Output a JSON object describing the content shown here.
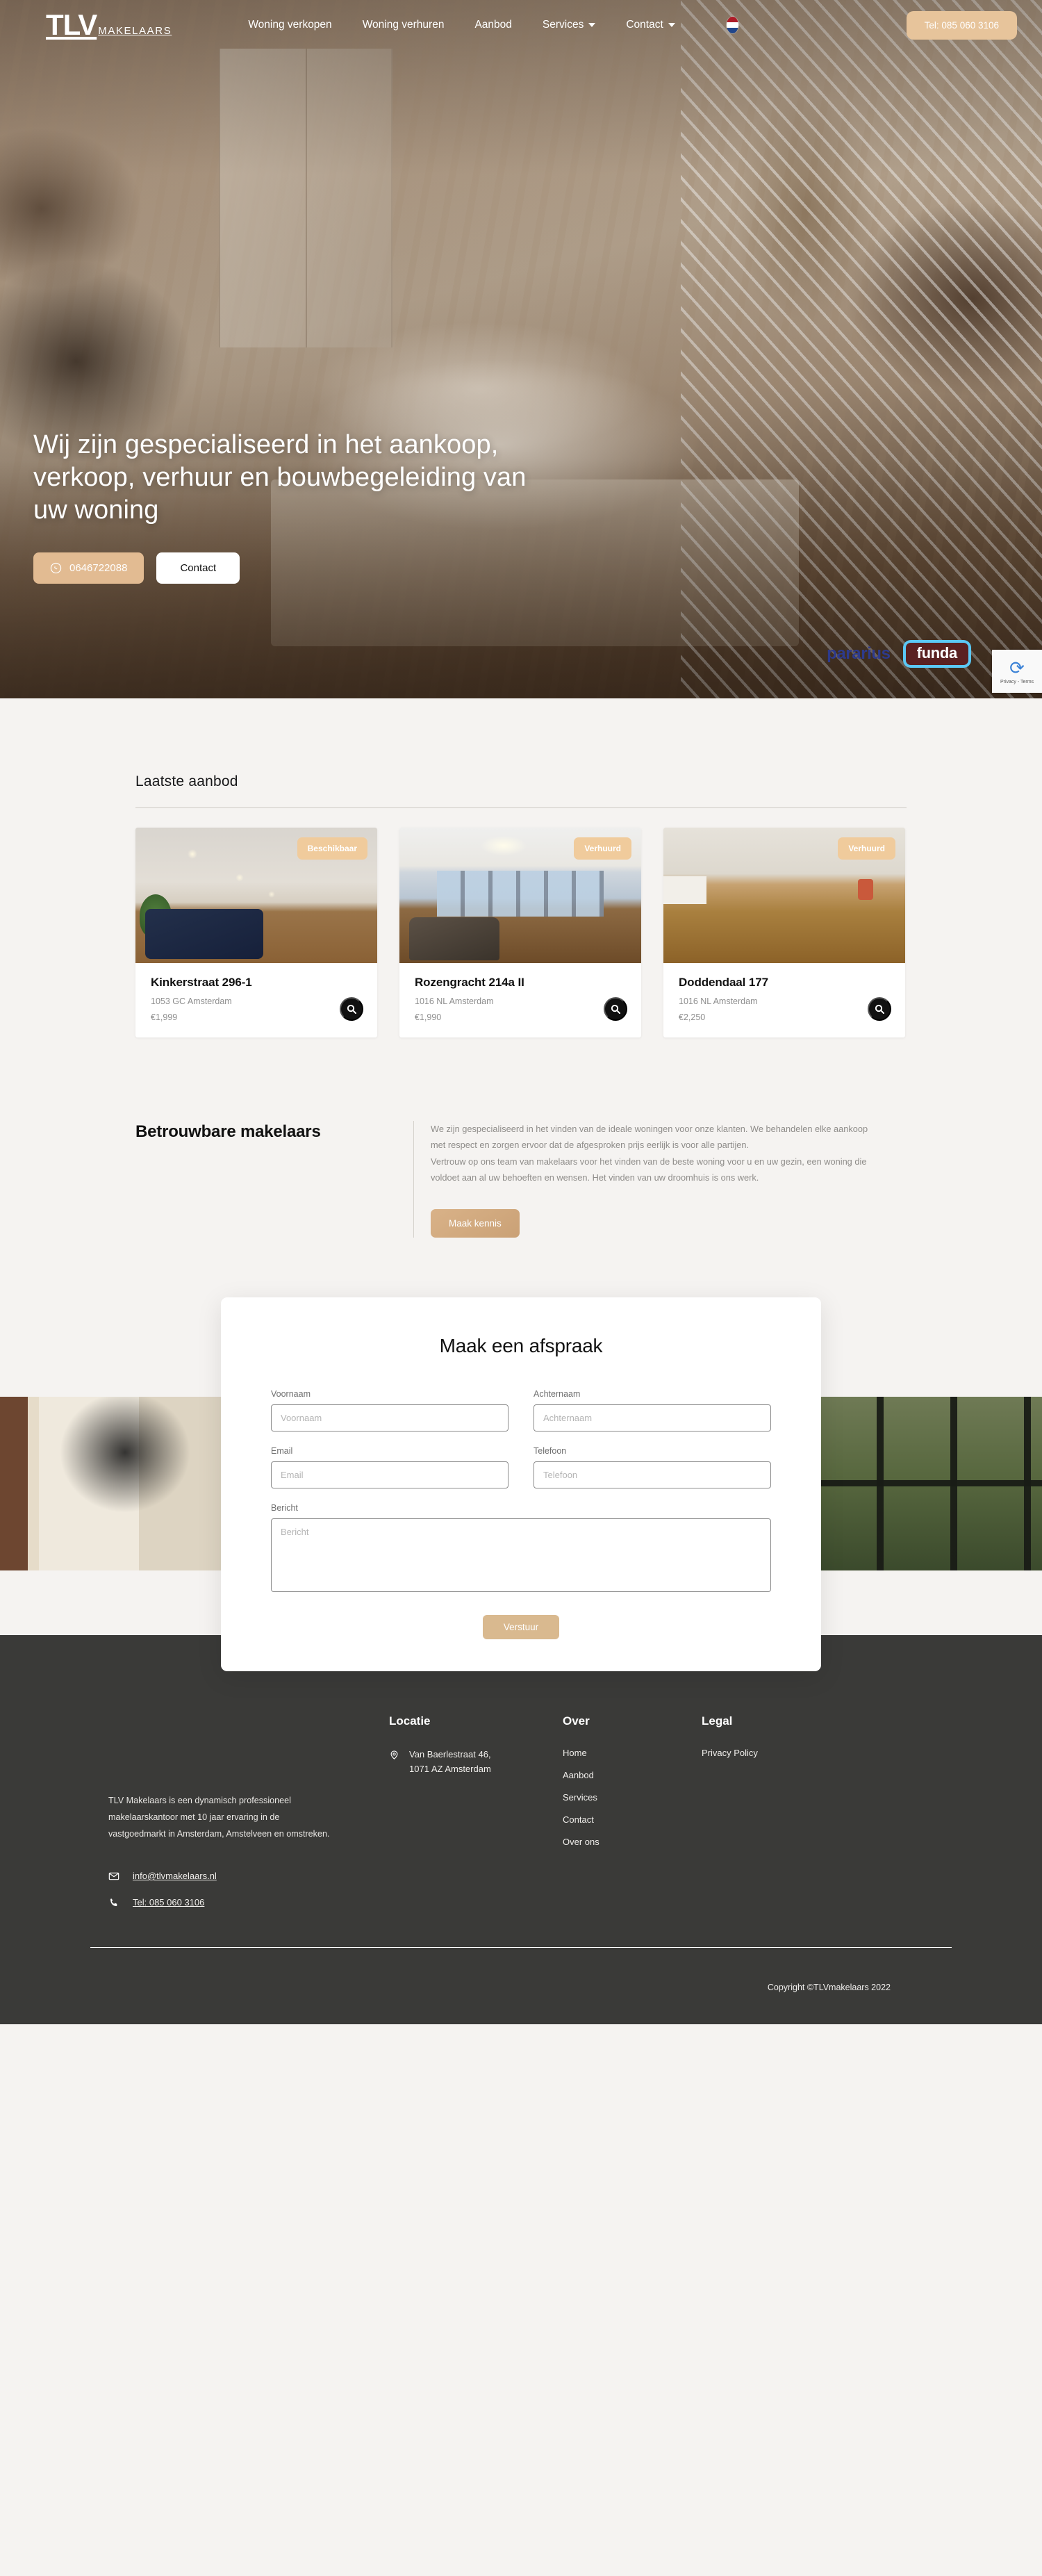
{
  "brand": {
    "logo_mark": "TLV",
    "logo_sub": "MAKELAARS"
  },
  "nav": {
    "links": [
      {
        "label": "Woning verkopen",
        "caret": false
      },
      {
        "label": "Woning verhuren",
        "caret": false
      },
      {
        "label": "Aanbod",
        "caret": false
      },
      {
        "label": "Services",
        "caret": true
      },
      {
        "label": "Contact",
        "caret": true
      }
    ],
    "flag_alt": "nl-flag-icon",
    "cta": "Tel: 085 060 3106"
  },
  "hero": {
    "title": "Wij zijn gespecialiseerd in het aankoop, verkoop, verhuur en bouwbegeleiding van uw woning",
    "whatsapp_btn": "0646722088",
    "contact_btn": "Contact",
    "partners": [
      {
        "name": "pararius"
      },
      {
        "name": "funda"
      }
    ],
    "recaptcha_text": "Privacy - Terms"
  },
  "listings": {
    "title": "Laatste aanbod",
    "cards": [
      {
        "badge": "Beschikbaar",
        "title": "Kinkerstraat 296-1",
        "address": "1053 GC Amsterdam",
        "price": "€1,999"
      },
      {
        "badge": "Verhuurd",
        "title": "Rozengracht 214a II",
        "address": "1016 NL Amsterdam",
        "price": "€1,990"
      },
      {
        "badge": "Verhuurd",
        "title": "Doddendaal 177",
        "address": "1016 NL Amsterdam",
        "price": "€2,250"
      }
    ]
  },
  "about": {
    "heading": "Betrouwbare makelaars",
    "paragraph1": "We zijn gespecialiseerd in het vinden van de ideale woningen voor onze klanten. We behandelen elke aankoop met respect en zorgen ervoor dat de afgesproken prijs eerlijk is voor alle partijen.",
    "paragraph2": "Vertrouw op ons team van makelaars voor het vinden van de beste woning voor u en uw gezin, een woning die voldoet aan al uw behoeften en wensen. Het vinden van uw droomhuis is ons werk.",
    "button": "Maak kennis"
  },
  "contact_form": {
    "heading": "Maak een afspraak",
    "fields": {
      "voornaam_label": "Voornaam",
      "voornaam_placeholder": "Voornaam",
      "achternaam_label": "Achternaam",
      "achternaam_placeholder": "Achternaam",
      "email_label": "Email",
      "email_placeholder": "Email",
      "telefoon_label": "Telefoon",
      "telefoon_placeholder": "Telefoon",
      "bericht_label": "Bericht",
      "bericht_placeholder": "Bericht"
    },
    "submit": "Verstuur"
  },
  "footer": {
    "about_text": "TLV Makelaars is een dynamisch professioneel makelaarskantoor met 10 jaar ervaring in de vastgoedmarkt in Amsterdam, Amstelveen en omstreken.",
    "email": "info@tlvmakelaars.nl",
    "phone": "Tel: 085 060 3106",
    "locatie": {
      "heading": "Locatie",
      "address_line1": "Van Baerlestraat 46,",
      "address_line2": "1071 AZ Amsterdam"
    },
    "over": {
      "heading": "Over",
      "links": [
        "Home",
        "Aanbod",
        "Services",
        "Contact",
        "Over ons"
      ]
    },
    "legal": {
      "heading": "Legal",
      "links": [
        "Privacy Policy"
      ]
    },
    "copyright": "Copyright ©TLVmakelaars 2022"
  },
  "colors": {
    "accent": "#e2bb92",
    "accent_dark": "#caa176",
    "footer_bg": "#3a3a38",
    "page_bg": "#f5f3f1",
    "badge": "#f0cb9c"
  }
}
